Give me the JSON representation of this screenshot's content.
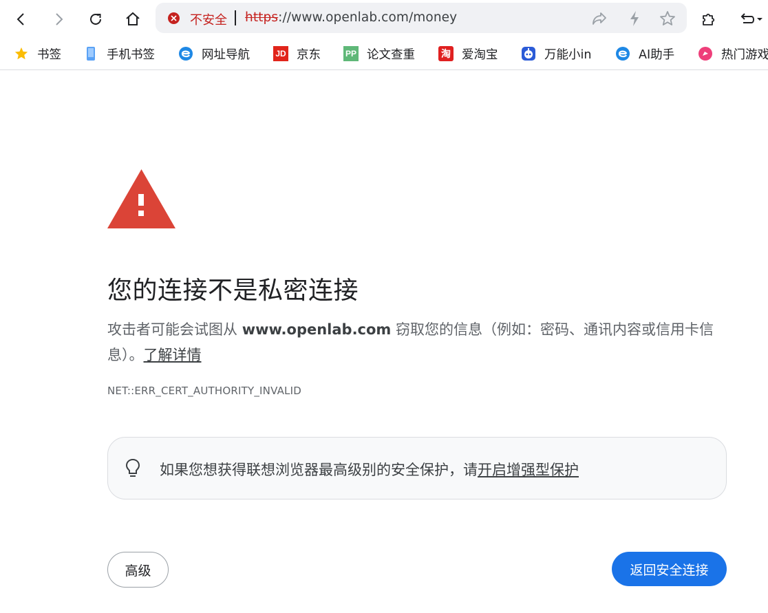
{
  "toolbar": {
    "back_icon": "back-arrow-icon",
    "forward_icon": "forward-arrow-icon",
    "reload_icon": "reload-icon",
    "home_icon": "home-icon",
    "extensions_icon": "puzzle-icon",
    "undo_menu_icon": "undo-dropdown-icon"
  },
  "omnibox": {
    "security_label": "不安全",
    "url_scheme": "https",
    "url_rest": "://www.openlab.com/money",
    "share_icon": "share-icon",
    "lightning_icon": "lightning-icon",
    "star_icon": "star-outline-icon"
  },
  "bookmarks": [
    {
      "label": "书签",
      "icon": "star-icon"
    },
    {
      "label": "手机书签",
      "icon": "phone-icon"
    },
    {
      "label": "网址导航",
      "icon": "browser-e-icon"
    },
    {
      "label": "京东",
      "icon": "jd-icon"
    },
    {
      "label": "论文查重",
      "icon": "pp-icon"
    },
    {
      "label": "爱淘宝",
      "icon": "taobao-icon"
    },
    {
      "label": "万能小in",
      "icon": "robot-icon"
    },
    {
      "label": "AI助手",
      "icon": "browser-e-icon"
    },
    {
      "label": "热门游戏",
      "icon": "game-icon"
    }
  ],
  "icon_texts": {
    "jd": "JD",
    "pp": "PP",
    "taobao": "淘"
  },
  "interstitial": {
    "heading": "您的连接不是私密连接",
    "desc_prefix": "攻击者可能会试图从 ",
    "desc_host": "www.openlab.com",
    "desc_suffix": " 窃取您的信息（例如：密码、通讯内容或信用卡信息）。",
    "learn_more": "了解详情",
    "error_code": "NET::ERR_CERT_AUTHORITY_INVALID",
    "tip_prefix": "如果您想获得联想浏览器最高级别的安全保护，请",
    "tip_link": "开启增强型保护",
    "advanced_button": "高级",
    "back_button": "返回安全连接"
  },
  "colors": {
    "danger": "#c5221f",
    "triangle": "#db4437",
    "primary_button": "#1a73e8"
  }
}
